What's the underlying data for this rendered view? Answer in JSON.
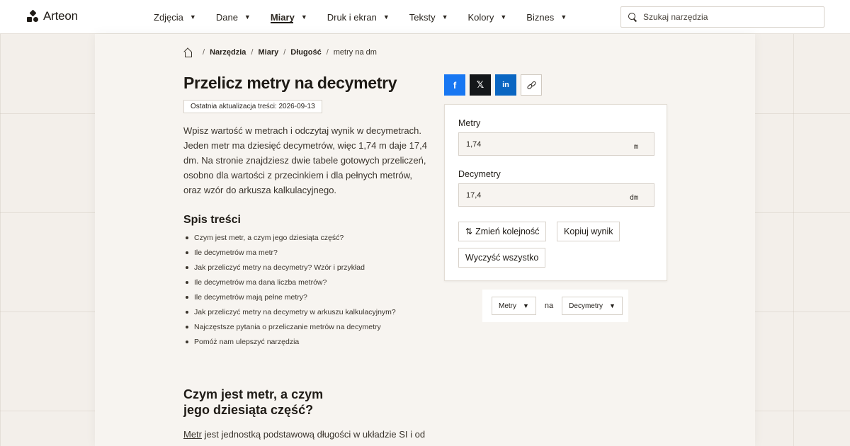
{
  "header": {
    "logo_text": "Arteon",
    "nav": [
      {
        "label": "Zdjęcia",
        "active": false
      },
      {
        "label": "Dane",
        "active": false
      },
      {
        "label": "Miary",
        "active": true
      },
      {
        "label": "Druk i ekran",
        "active": false
      },
      {
        "label": "Teksty",
        "active": false
      },
      {
        "label": "Kolory",
        "active": false
      },
      {
        "label": "Biznes",
        "active": false
      }
    ],
    "search_placeholder": "Szukaj narzędzia"
  },
  "breadcrumb": {
    "items": [
      "Narzędzia",
      "Miary",
      "Długość"
    ],
    "current": "metry na dm"
  },
  "page": {
    "title": "Przelicz metry na decymetry",
    "updated": "Ostatnia aktualizacja treści: 2026-09-13",
    "intro": "Wpisz wartość w metrach i odczytaj wynik w decymetrach. Jeden metr ma dziesięć decymetrów, więc 1,74 m daje 17,4 dm. Na stronie znajdziesz dwie tabele gotowych przeliczeń, osobno dla wartości z przecinkiem i dla pełnych metrów, oraz wzór do arkusza kalkulacyjnego.",
    "toc_title": "Spis treści",
    "toc": [
      "Czym jest metr, a czym jego dziesiąta część?",
      "Ile decymetrów ma metr?",
      "Jak przeliczyć metry na decymetry? Wzór i przykład",
      "Ile decymetrów ma dana liczba metrów?",
      "Ile decymetrów mają pełne metry?",
      "Jak przeliczyć metry na decymetry w arkuszu kalkulacyjnym?",
      "Najczęstsze pytania o przeliczanie metrów na decymetry",
      "Pomóż nam ulepszyć narzędzia"
    ],
    "section_title": "Czym jest metr, a czym jego dziesiąta część?",
    "section_link": "Metr",
    "section_text": " jest jednostką podstawową długości w układzie SI i od"
  },
  "share": {
    "facebook": "f",
    "x": "𝕏",
    "linkedin": "in"
  },
  "converter": {
    "from_label": "Metry",
    "from_value": "1,74",
    "from_unit": "m",
    "to_label": "Decymetry",
    "to_value": "17,4",
    "to_unit": "dm",
    "swap_icon": "⇅",
    "swap_label": "Zmień kolejność",
    "copy_label": "Kopiuj wynik",
    "clear_label": "Wyczyść wszystko"
  },
  "unit_picker": {
    "from": "Metry",
    "connector": "na",
    "to": "Decymetry"
  }
}
